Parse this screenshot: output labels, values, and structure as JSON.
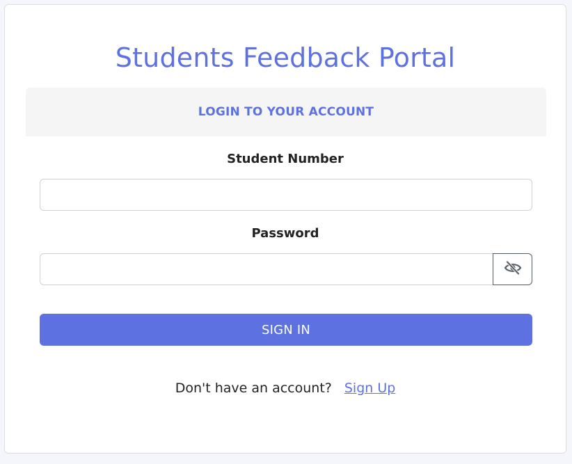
{
  "app": {
    "title": "Students Feedback Portal"
  },
  "login_card": {
    "header": "LOGIN TO YOUR ACCOUNT",
    "student_number_label": "Student Number",
    "student_number_value": "",
    "password_label": "Password",
    "password_value": "",
    "toggle_visibility_icon": "eye-slash-icon",
    "sign_in_label": "SIGN IN",
    "no_account_text": "Don't have an account?",
    "sign_up_label": "Sign Up"
  },
  "colors": {
    "accent": "#5d72e0",
    "header_bg": "#f5f5f6",
    "text": "#222222"
  }
}
